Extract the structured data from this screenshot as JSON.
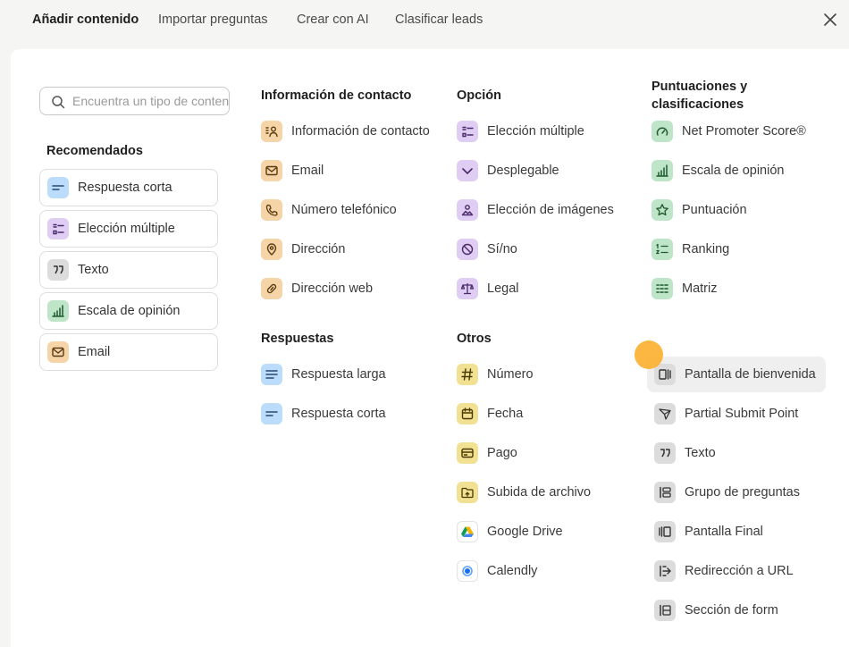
{
  "tabs": [
    {
      "label": "Añadir contenido",
      "active": true
    },
    {
      "label": "Importar preguntas"
    },
    {
      "label": "Crear con AI"
    },
    {
      "label": "Clasificar leads"
    }
  ],
  "search": {
    "placeholder": "Encuentra un tipo de contenido"
  },
  "recommended": {
    "heading": "Recomendados",
    "items": [
      {
        "label": "Respuesta corta",
        "icon": "short-text-icon",
        "color": "#bcdcfb"
      },
      {
        "label": "Elección múltiple",
        "icon": "multiple-choice-icon",
        "color": "#e0cdf4"
      },
      {
        "label": "Texto",
        "icon": "quote-icon",
        "color": "#dcdcdc"
      },
      {
        "label": "Escala de opinión",
        "icon": "bar-chart-icon",
        "color": "#bfe5c8"
      },
      {
        "label": "Email",
        "icon": "envelope-icon",
        "color": "#f5d5a8"
      }
    ]
  },
  "contact": {
    "heading": "Información de contacto",
    "items": [
      {
        "label": "Información de contacto",
        "icon": "contact-card-icon"
      },
      {
        "label": "Email",
        "icon": "envelope-icon"
      },
      {
        "label": "Número telefónico",
        "icon": "phone-icon"
      },
      {
        "label": "Dirección",
        "icon": "location-pin-icon"
      },
      {
        "label": "Dirección web",
        "icon": "link-icon"
      }
    ]
  },
  "answers": {
    "heading": "Respuestas",
    "items": [
      {
        "label": "Respuesta larga",
        "icon": "long-text-icon"
      },
      {
        "label": "Respuesta corta",
        "icon": "short-text-icon"
      }
    ]
  },
  "option": {
    "heading": "Opción",
    "items": [
      {
        "label": "Elección múltiple",
        "icon": "multiple-choice-icon"
      },
      {
        "label": "Desplegable",
        "icon": "chevron-down-icon"
      },
      {
        "label": "Elección de imágenes",
        "icon": "image-choice-icon"
      },
      {
        "label": "Sí/no",
        "icon": "yes-no-icon"
      },
      {
        "label": "Legal",
        "icon": "scales-icon"
      }
    ]
  },
  "others": {
    "heading": "Otros",
    "items": [
      {
        "label": "Número",
        "icon": "hash-icon"
      },
      {
        "label": "Fecha",
        "icon": "calendar-icon"
      },
      {
        "label": "Pago",
        "icon": "credit-card-icon"
      },
      {
        "label": "Subida de archivo",
        "icon": "folder-upload-icon"
      },
      {
        "label": "Google Drive",
        "icon": "google-drive-icon"
      },
      {
        "label": "Calendly",
        "icon": "calendly-icon"
      }
    ]
  },
  "ratings": {
    "heading": "Puntuaciones y clasificaciones",
    "items": [
      {
        "label": "Net Promoter Score®",
        "icon": "gauge-icon"
      },
      {
        "label": "Escala de opinión",
        "icon": "bar-chart-icon"
      },
      {
        "label": "Puntuación",
        "icon": "star-icon"
      },
      {
        "label": "Ranking",
        "icon": "ranking-icon"
      },
      {
        "label": "Matriz",
        "icon": "grid-icon"
      }
    ]
  },
  "screens": {
    "items": [
      {
        "label": "Pantalla de bienvenida",
        "icon": "welcome-screen-icon",
        "hovered": true
      },
      {
        "label": "Partial Submit Point",
        "icon": "send-icon"
      },
      {
        "label": "Texto",
        "icon": "quote-icon"
      },
      {
        "label": "Grupo de preguntas",
        "icon": "question-group-icon"
      },
      {
        "label": "Pantalla Final",
        "icon": "end-screen-icon"
      },
      {
        "label": "Redirección a URL",
        "icon": "redirect-icon"
      },
      {
        "label": "Sección de form",
        "icon": "form-section-icon"
      }
    ]
  }
}
